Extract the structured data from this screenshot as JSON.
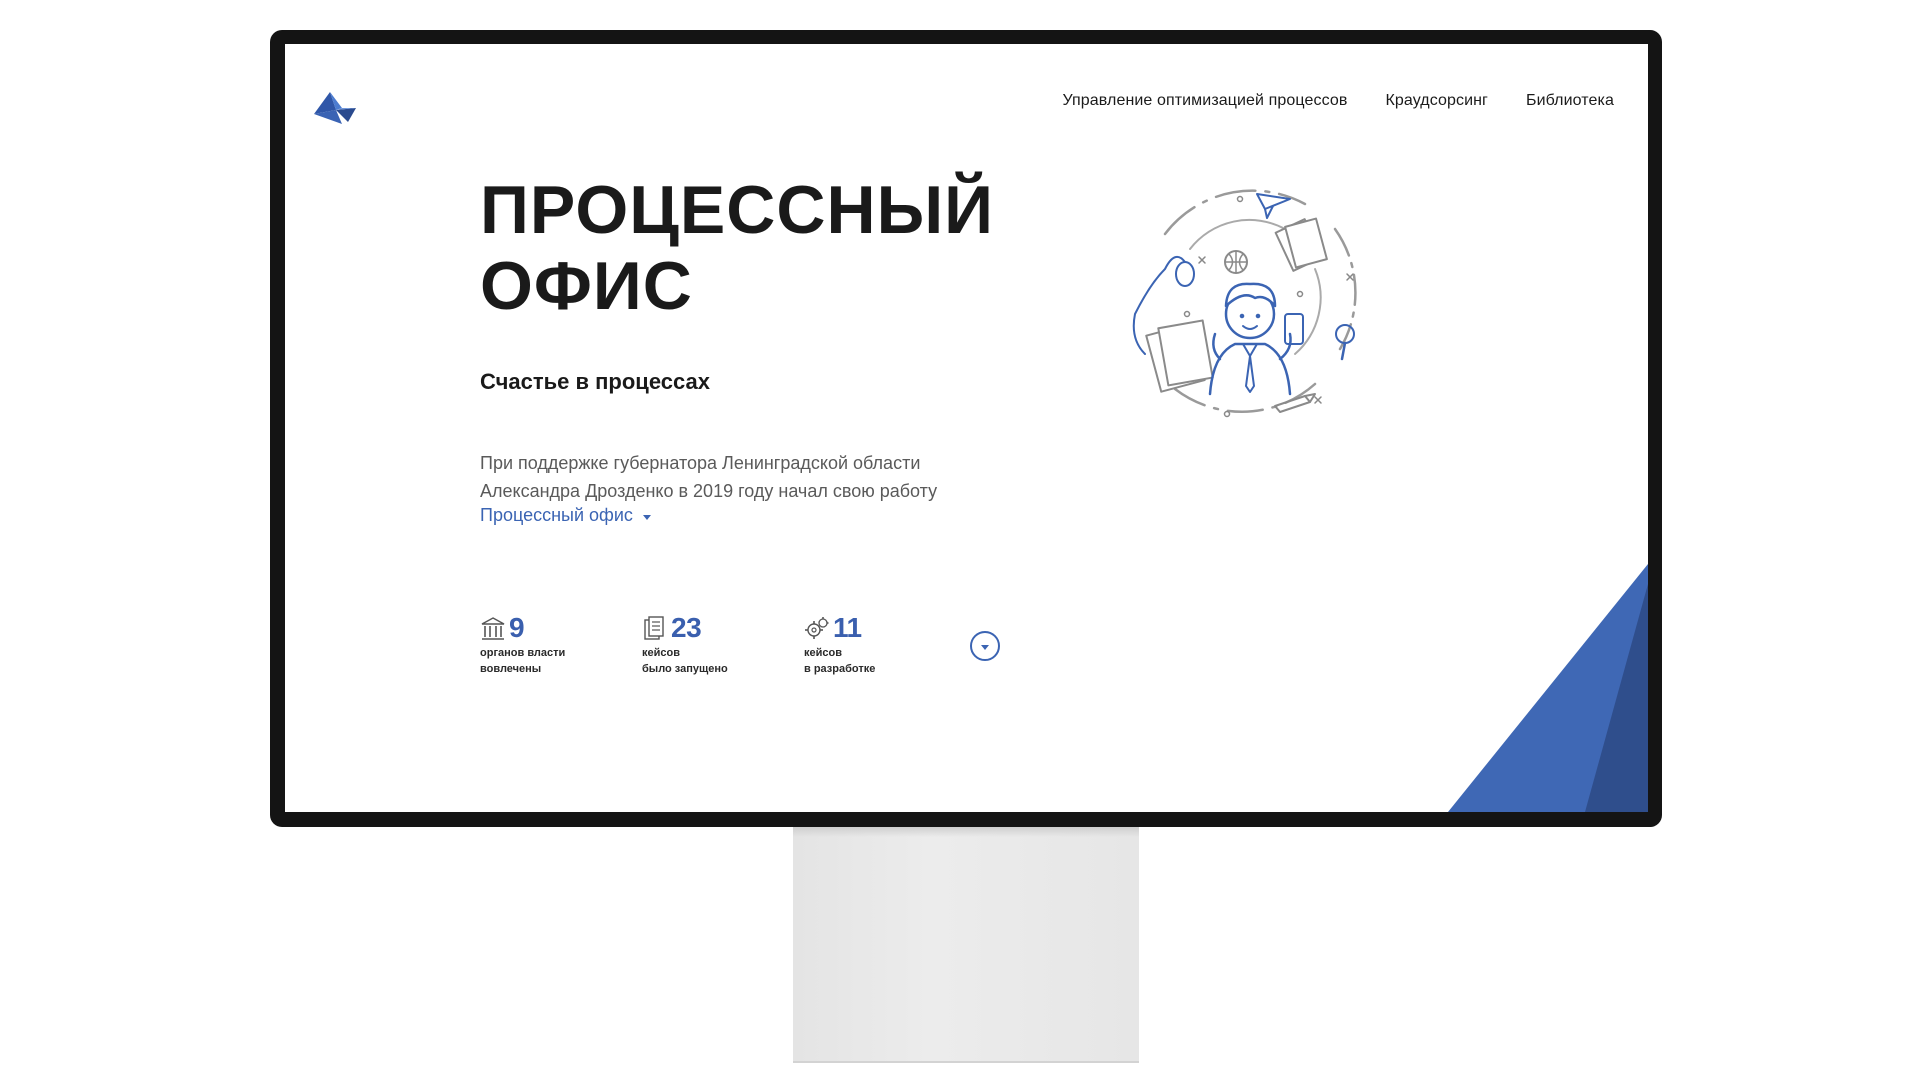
{
  "header": {
    "nav": [
      {
        "label": "Управление оптимизацией процессов"
      },
      {
        "label": "Краудсорсинг"
      },
      {
        "label": "Библиотека"
      }
    ]
  },
  "hero": {
    "title_line1": "ПРОЦЕССНЫЙ",
    "title_line2": "ОФИС",
    "subtitle": "Счастье в процессах",
    "desc_line1": "При поддержке губернатора Ленинградской области",
    "desc_line2": "Александра Дрозденко в 2019 году начал свою работу",
    "link": "Процессный офис"
  },
  "stats": [
    {
      "icon": "government-building-icon",
      "value": "9",
      "label_line1": "органов власти",
      "label_line2": "вовлечены"
    },
    {
      "icon": "documents-icon",
      "value": "23",
      "label_line1": "кейсов",
      "label_line2": "было запущено"
    },
    {
      "icon": "gears-icon",
      "value": "11",
      "label_line1": "кейсов",
      "label_line2": "в разработке"
    }
  ],
  "colors": {
    "accent": "#3b64b3",
    "corner_light": "#3f68b5",
    "corner_dark": "#2f4e8c",
    "monitor_frame": "#141414"
  }
}
